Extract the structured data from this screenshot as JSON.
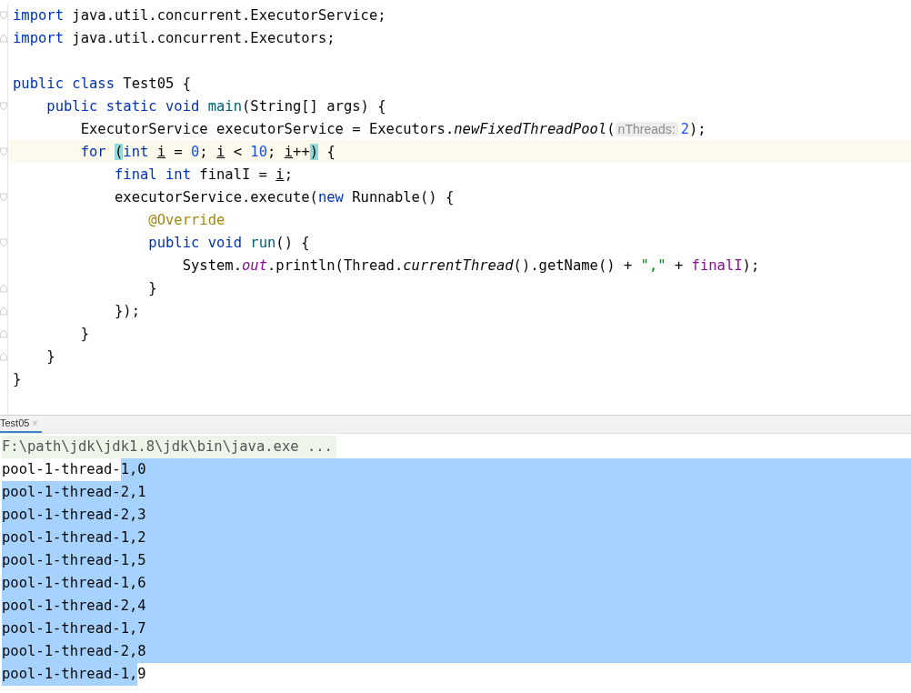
{
  "editor": {
    "lines": [
      {
        "fold_open": true,
        "fold_close": false,
        "current": false,
        "tokens": [
          {
            "text": "import",
            "kind": "kw"
          },
          {
            "text": " java.util.concurrent.ExecutorService;",
            "kind": "plain"
          }
        ]
      },
      {
        "fold_open": false,
        "fold_close": true,
        "current": false,
        "tokens": [
          {
            "text": "import",
            "kind": "kw"
          },
          {
            "text": " java.util.concurrent.Executors;",
            "kind": "plain"
          }
        ]
      },
      {
        "fold_open": false,
        "fold_close": false,
        "current": false
      },
      {
        "fold_open": false,
        "fold_close": false,
        "current": false,
        "tokens": [
          {
            "text": "public class",
            "kind": "kw"
          },
          {
            "text": " Test05 {",
            "kind": "plain"
          }
        ]
      },
      {
        "fold_open": true,
        "fold_close": false,
        "current": false,
        "tokens": [
          {
            "text": "    public static void ",
            "kind": "kw"
          },
          {
            "text": "main",
            "kind": "fn"
          },
          {
            "text": "(String[] args) {",
            "kind": "plain"
          }
        ]
      },
      {
        "fold_open": false,
        "fold_close": false,
        "current": false,
        "tokens": [
          {
            "text": "        ExecutorService executorService = Executors.",
            "kind": "plain"
          },
          {
            "text": "newFixedThreadPool",
            "kind": "italic"
          },
          {
            "text": "(",
            "kind": "plain"
          },
          {
            "text": "nThreads:",
            "kind": "hint"
          },
          {
            "text": "2",
            "kind": "num"
          },
          {
            "text": ");",
            "kind": "plain"
          }
        ]
      },
      {
        "fold_open": true,
        "fold_close": false,
        "current": true,
        "tokens": [
          {
            "text": "        for ",
            "kind": "kw"
          },
          {
            "text": "(",
            "kind": "brace"
          },
          {
            "text": "int ",
            "kind": "kw"
          },
          {
            "text": "i",
            "kind": "var"
          },
          {
            "text": " = ",
            "kind": "plain"
          },
          {
            "text": "0",
            "kind": "num"
          },
          {
            "text": "; ",
            "kind": "plain"
          },
          {
            "text": "i",
            "kind": "var"
          },
          {
            "text": " < ",
            "kind": "plain"
          },
          {
            "text": "10",
            "kind": "num"
          },
          {
            "text": "; ",
            "kind": "plain"
          },
          {
            "text": "i",
            "kind": "var"
          },
          {
            "text": "++",
            "kind": "plain"
          },
          {
            "text": ")",
            "kind": "brace"
          },
          {
            "text": " {",
            "kind": "plain"
          }
        ]
      },
      {
        "fold_open": false,
        "fold_close": false,
        "current": false,
        "tokens": [
          {
            "text": "            final int",
            "kind": "kw"
          },
          {
            "text": " finalI = ",
            "kind": "plain"
          },
          {
            "text": "i",
            "kind": "var"
          },
          {
            "text": ";",
            "kind": "plain"
          }
        ]
      },
      {
        "fold_open": true,
        "fold_close": false,
        "current": false,
        "tokens": [
          {
            "text": "            executorService.execute(",
            "kind": "plain"
          },
          {
            "text": "new",
            "kind": "kw"
          },
          {
            "text": " Runnable() {",
            "kind": "plain"
          }
        ]
      },
      {
        "fold_open": false,
        "fold_close": false,
        "current": false,
        "tokens": [
          {
            "text": "                @Override",
            "kind": "anno"
          }
        ]
      },
      {
        "fold_open": true,
        "fold_close": false,
        "current": false,
        "tokens": [
          {
            "text": "                public void ",
            "kind": "kw"
          },
          {
            "text": "run",
            "kind": "fn"
          },
          {
            "text": "() {",
            "kind": "plain"
          }
        ]
      },
      {
        "fold_open": false,
        "fold_close": false,
        "current": false,
        "tokens": [
          {
            "text": "                    System.",
            "kind": "plain"
          },
          {
            "text": "out",
            "kind": "field"
          },
          {
            "text": ".println(Thread.",
            "kind": "plain"
          },
          {
            "text": "currentThread",
            "kind": "italic"
          },
          {
            "text": "().getName() + ",
            "kind": "plain"
          },
          {
            "text": "\",\"",
            "kind": "str"
          },
          {
            "text": " + ",
            "kind": "plain"
          },
          {
            "text": "finalI",
            "kind": "member"
          },
          {
            "text": ");",
            "kind": "plain"
          }
        ]
      },
      {
        "fold_open": false,
        "fold_close": true,
        "current": false,
        "tokens": [
          {
            "text": "                }",
            "kind": "plain"
          }
        ]
      },
      {
        "fold_open": false,
        "fold_close": true,
        "current": false,
        "tokens": [
          {
            "text": "            });",
            "kind": "plain"
          }
        ]
      },
      {
        "fold_open": false,
        "fold_close": true,
        "current": false,
        "tokens": [
          {
            "text": "        }",
            "kind": "plain"
          }
        ]
      },
      {
        "fold_open": false,
        "fold_close": true,
        "current": false,
        "tokens": [
          {
            "text": "    }",
            "kind": "plain"
          }
        ]
      },
      {
        "fold_open": false,
        "fold_close": false,
        "current": false,
        "tokens": [
          {
            "text": "}",
            "kind": "plain"
          }
        ]
      }
    ]
  },
  "console": {
    "tabs": [
      {
        "label": "Test05",
        "selected": true,
        "close": "×"
      }
    ],
    "command": "F:\\path\\jdk\\jdk1.8\\jdk\\bin\\java.exe ...",
    "lines": [
      [
        {
          "text": "pool-1-thread-",
          "selected": false
        },
        {
          "text": "1,0",
          "selected": true
        }
      ],
      [
        {
          "text": "pool-1-thread-2,1",
          "selected": true
        }
      ],
      [
        {
          "text": "pool-1-thread-2,3",
          "selected": true
        }
      ],
      [
        {
          "text": "pool-1-thread-1,2",
          "selected": true
        }
      ],
      [
        {
          "text": "pool-1-thread-1,5",
          "selected": true
        }
      ],
      [
        {
          "text": "pool-1-thread-1,6",
          "selected": true
        }
      ],
      [
        {
          "text": "pool-1-thread-2,4",
          "selected": true
        }
      ],
      [
        {
          "text": "pool-1-thread-1,7",
          "selected": true
        }
      ],
      [
        {
          "text": "pool-1-thread-2,8",
          "selected": true
        }
      ],
      [
        {
          "text": "pool-1-thread-1,",
          "selected": true
        },
        {
          "text": "9",
          "selected": false
        }
      ]
    ]
  }
}
